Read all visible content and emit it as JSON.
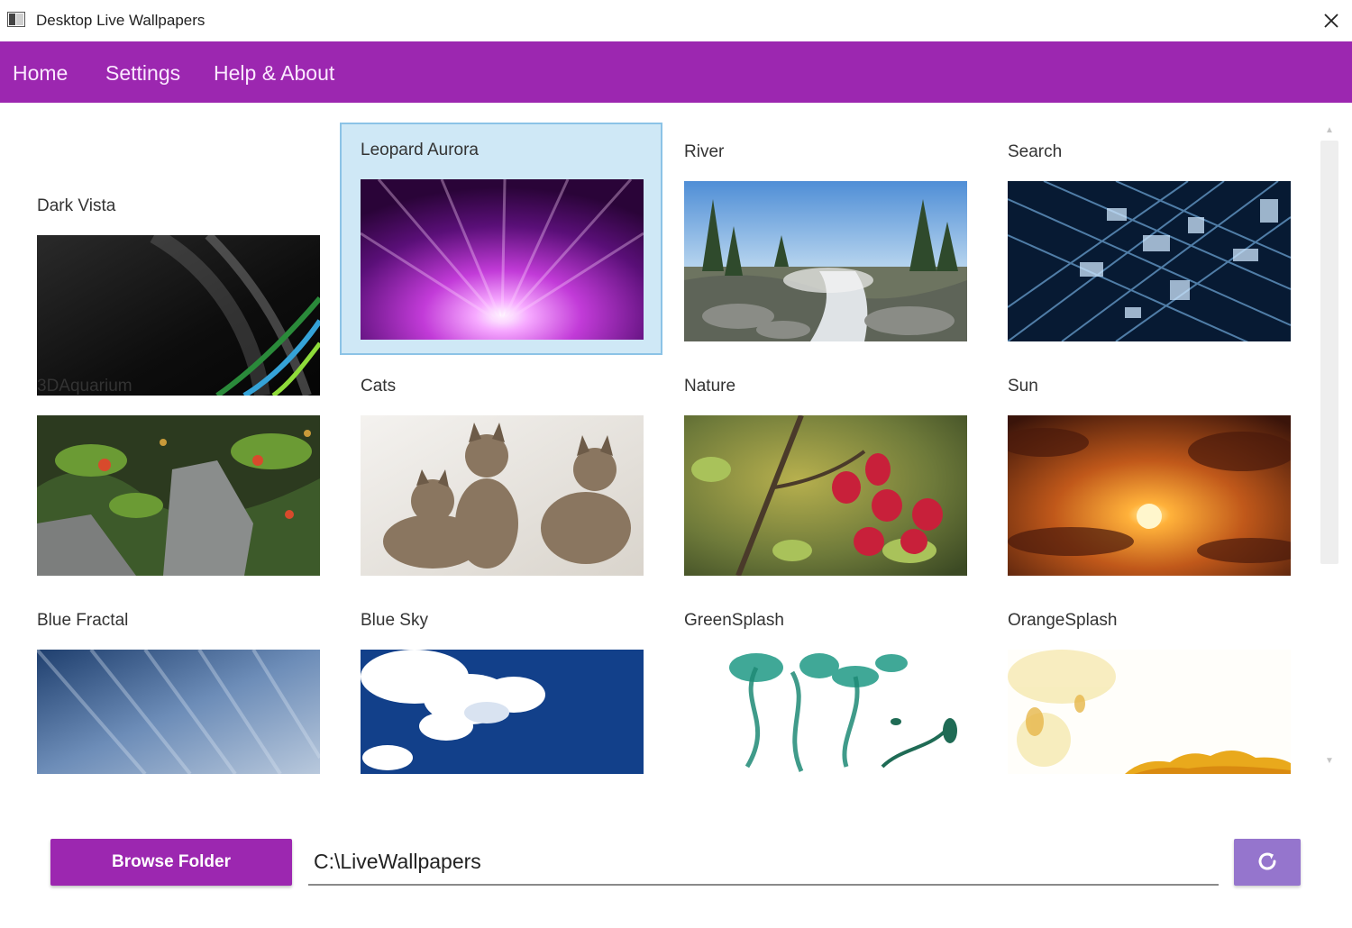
{
  "window": {
    "title": "Desktop Live Wallpapers",
    "close_icon": "close-icon"
  },
  "nav": {
    "items": [
      "Home",
      "Settings",
      "Help & About"
    ]
  },
  "wallpapers": [
    {
      "name": "Dark Vista",
      "selected": false
    },
    {
      "name": "Leopard Aurora",
      "selected": true
    },
    {
      "name": "River",
      "selected": false
    },
    {
      "name": "Search",
      "selected": false
    },
    {
      "name": "3DAquarium",
      "selected": false
    },
    {
      "name": "Cats",
      "selected": false
    },
    {
      "name": "Nature",
      "selected": false
    },
    {
      "name": "Sun",
      "selected": false
    },
    {
      "name": "Blue Fractal",
      "selected": false
    },
    {
      "name": "Blue Sky",
      "selected": false
    },
    {
      "name": "GreenSplash",
      "selected": false
    },
    {
      "name": "OrangeSplash",
      "selected": false
    }
  ],
  "footer": {
    "browse_label": "Browse Folder",
    "folder_path": "C:\\LiveWallpapers",
    "refresh_icon": "refresh-icon"
  },
  "colors": {
    "accent": "#9c27b0",
    "refresh_button": "#9575cd",
    "selected_tile": "#cfe8f6"
  }
}
